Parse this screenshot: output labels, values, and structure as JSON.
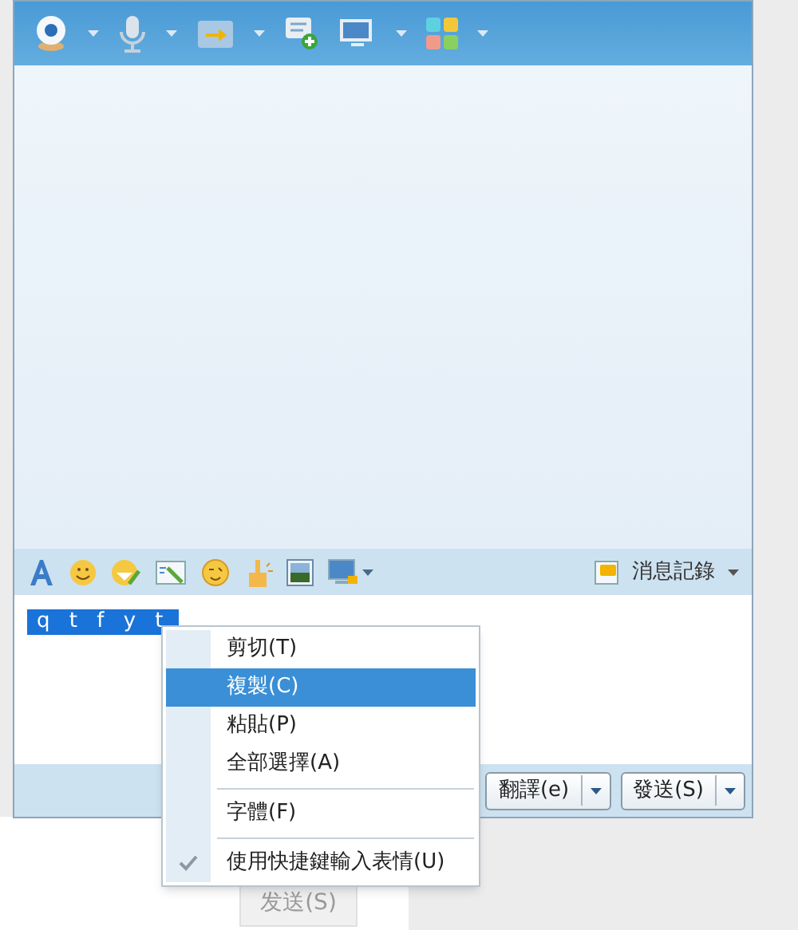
{
  "input_toolbar": {
    "history_label": "消息記錄"
  },
  "input": {
    "value": "q t f y t"
  },
  "context_menu": [
    {
      "kind": "item",
      "label": "剪切(T)",
      "selected": false,
      "checked": false
    },
    {
      "kind": "item",
      "label": "複製(C)",
      "selected": true,
      "checked": false
    },
    {
      "kind": "item",
      "label": "粘貼(P)",
      "selected": false,
      "checked": false
    },
    {
      "kind": "item",
      "label": "全部選擇(A)",
      "selected": false,
      "checked": false
    },
    {
      "kind": "separator"
    },
    {
      "kind": "item",
      "label": "字體(F)",
      "selected": false,
      "checked": false
    },
    {
      "kind": "separator"
    },
    {
      "kind": "item",
      "label": "使用快捷鍵輸入表情(U)",
      "selected": false,
      "checked": true
    }
  ],
  "buttons": [
    {
      "label": "翻譯(e)"
    },
    {
      "label": "發送(S)"
    }
  ],
  "background_window": {
    "button": "发送(S)"
  }
}
